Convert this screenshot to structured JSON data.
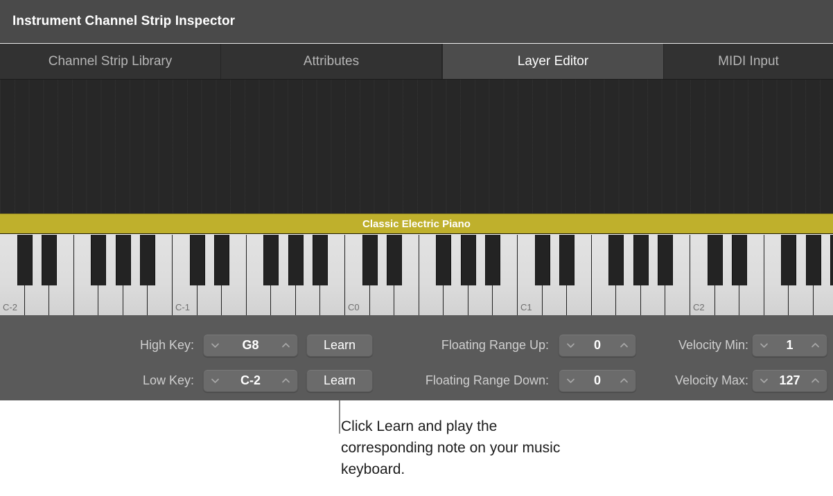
{
  "window": {
    "title": "Instrument Channel Strip Inspector"
  },
  "tabs": [
    {
      "label": "Channel Strip Library",
      "active": false
    },
    {
      "label": "Attributes",
      "active": false
    },
    {
      "label": "Layer Editor",
      "active": true
    },
    {
      "label": "MIDI Input",
      "active": false
    }
  ],
  "layer": {
    "name": "Classic Electric Piano",
    "color": "#bfb02c"
  },
  "keyboard": {
    "octave_labels": [
      "C-2",
      "C-1",
      "C0",
      "C1",
      "C2"
    ],
    "low_key": "C-2",
    "high_key": "G8"
  },
  "params": {
    "high_key": {
      "label": "High Key:",
      "value": "G8",
      "down_icon": "chevron-down-icon",
      "up_icon": "chevron-up-icon"
    },
    "low_key": {
      "label": "Low Key:",
      "value": "C-2",
      "down_icon": "chevron-down-icon",
      "up_icon": "chevron-up-icon"
    },
    "floating_range_up": {
      "label": "Floating Range Up:",
      "value": "0"
    },
    "floating_range_down": {
      "label": "Floating Range Down:",
      "value": "0"
    },
    "velocity_min": {
      "label": "Velocity Min:",
      "value": "1"
    },
    "velocity_max": {
      "label": "Velocity Max:",
      "value": "127"
    },
    "learn_high_label": "Learn",
    "learn_low_label": "Learn"
  },
  "callout": {
    "text": "Click Learn and play the corresponding note on your music keyboard."
  }
}
